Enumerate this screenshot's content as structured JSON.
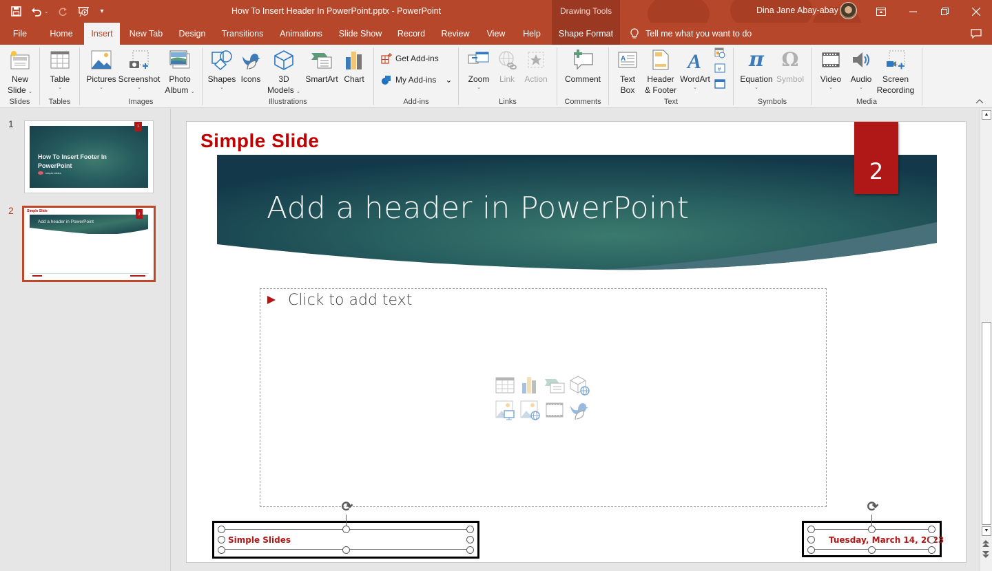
{
  "window": {
    "title": "How To Insert Header In PowerPoint.pptx  -  PowerPoint",
    "contextual_group": "Drawing Tools",
    "user_name": "Dina Jane Abay-abay",
    "controls": {
      "ribbon_display": "▭",
      "minimize": "—",
      "restore": "❐",
      "close": "✕"
    }
  },
  "qat": {
    "save_icon": "💾",
    "undo_icon": "↶",
    "undo_caret": "⌄",
    "redo_icon": "↻",
    "present_icon": "⧉",
    "customize_icon": "▾"
  },
  "tabs": [
    {
      "label": "File"
    },
    {
      "label": "Home"
    },
    {
      "label": "Insert",
      "active": true
    },
    {
      "label": "New Tab"
    },
    {
      "label": "Design"
    },
    {
      "label": "Transitions"
    },
    {
      "label": "Animations"
    },
    {
      "label": "Slide Show"
    },
    {
      "label": "Record"
    },
    {
      "label": "Review"
    },
    {
      "label": "View"
    },
    {
      "label": "Help"
    },
    {
      "label": "Shape Format",
      "contextual": true
    }
  ],
  "tell_me": {
    "icon": "lightbulb",
    "placeholder": "Tell me what you want to do"
  },
  "ribbon": {
    "groups": {
      "slides": "Slides",
      "tables": "Tables",
      "images": "Images",
      "illustrations": "Illustrations",
      "addins": "Add-ins",
      "links": "Links",
      "comments": "Comments",
      "text": "Text",
      "symbols": "Symbols",
      "media": "Media"
    },
    "buttons": {
      "new_slide": [
        "New",
        "Slide"
      ],
      "table": "Table",
      "pictures": "Pictures",
      "screenshot": "Screenshot",
      "photo_album": [
        "Photo",
        "Album"
      ],
      "shapes": "Shapes",
      "icons": "Icons",
      "models_3d": [
        "3D",
        "Models"
      ],
      "smartart": "SmartArt",
      "chart": "Chart",
      "get_addins": "Get Add-ins",
      "my_addins": "My Add-ins",
      "zoom": "Zoom",
      "link": "Link",
      "action": "Action",
      "comment": "Comment",
      "text_box": [
        "Text",
        "Box"
      ],
      "header_footer": [
        "Header",
        "& Footer"
      ],
      "wordart": "WordArt",
      "equation": "Equation",
      "symbol": "Symbol",
      "video": "Video",
      "audio": "Audio",
      "screen_recording": [
        "Screen",
        "Recording"
      ]
    },
    "disabled": [
      "Link",
      "Action",
      "Symbol"
    ]
  },
  "thumbnails": [
    {
      "number": "1",
      "title": "How To Insert Footer In PowerPoint",
      "brand": "simple slides",
      "badge": "1"
    },
    {
      "number": "2",
      "title": "Add a header in PowerPoint",
      "brand": "Simple Slide",
      "badge": "2",
      "selected": true
    }
  ],
  "slide": {
    "brand_text": "Simple Slide",
    "title": "Add a header in PowerPoint",
    "slide_number": "2",
    "content_placeholder": "Click to add text",
    "insert_icons": [
      "insert-table",
      "insert-chart",
      "insert-smartart",
      "insert-3d-model",
      "insert-picture",
      "insert-online-picture",
      "insert-video",
      "insert-icon"
    ],
    "footer_text": "Simple Slides",
    "date_text": "Tuesday, March 14, 2023"
  },
  "colors": {
    "accent": "#b7472a",
    "accent_dark": "#9a3822",
    "slide_red": "#b01717",
    "brand_red": "#c00000",
    "banner_teal": "#1f4e56"
  }
}
